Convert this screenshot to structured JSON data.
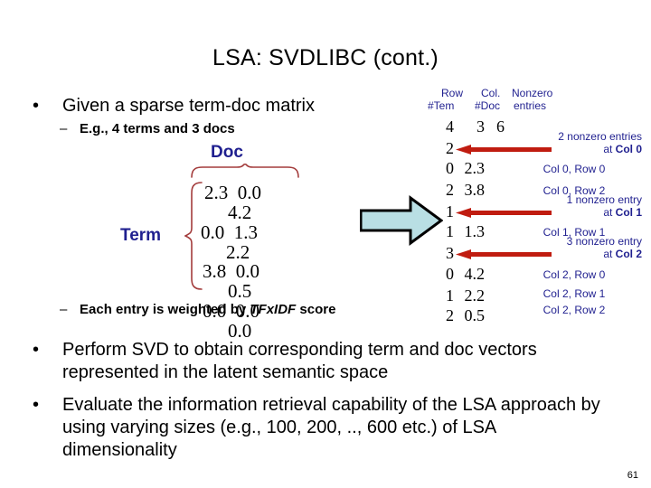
{
  "slide": {
    "title": "LSA: SVDLIBC (cont.)",
    "page_number": "61",
    "accent_blue": "#1f1f8f",
    "brace_red": "#a33c3c",
    "arrow_red": "#c01c10",
    "block_arrow_fill": "#b9dfe4"
  },
  "bullets": {
    "b1": "Given a sparse term-doc matrix",
    "sb1": "E.g., 4 terms and 3 docs",
    "sb2_pre": "Each entry is weighted by ",
    "sb2_ital": "TFxIDF",
    "sb2_post": " score",
    "b2": "Perform SVD to obtain corresponding term and doc vectors represented in the latent semantic space",
    "b3": "Evaluate the information retrieval capability of the LSA approach by using varying sizes (e.g., 100, 200, .., 600 etc.) of LSA dimensionality"
  },
  "matrix": {
    "doc_label": "Doc",
    "term_label": "Term",
    "rows": [
      {
        "first": "2.3  0.0",
        "second": "4.2"
      },
      {
        "first": "0.0  1.3",
        "second": "2.2"
      },
      {
        "first": "3.8  0.0",
        "second": "0.5"
      },
      {
        "first": "0.0  0.0",
        "second": "0.0"
      }
    ]
  },
  "table": {
    "headers": {
      "row": "Row",
      "col": "Col.",
      "nonzero": "Nonzero",
      "row_sub": "#Tem",
      "col_sub": "#Doc",
      "nonzero_sub": "entries"
    },
    "rows": [
      {
        "a": "4",
        "b": "3",
        "c": "6",
        "annot": "",
        "annot_bold": "",
        "arrow": false
      },
      {
        "a": "2",
        "b": "",
        "c": "",
        "annot": "2 nonzero entries",
        "annot2_pre": "at ",
        "annot_bold": "Col 0",
        "arrow": true
      },
      {
        "a": "0",
        "b": "2.3",
        "c": "",
        "annot": "Col 0, Row 0",
        "annot_bold": "",
        "arrow": false
      },
      {
        "a": "2",
        "b": "3.8",
        "c": "",
        "annot": "Col 0, Row 2",
        "annot_bold": "",
        "arrow": false
      },
      {
        "a": "1",
        "b": "",
        "c": "",
        "annot": "1 nonzero entry",
        "annot2_pre": "at ",
        "annot_bold": "Col 1",
        "arrow": true
      },
      {
        "a": "1",
        "b": "1.3",
        "c": "",
        "annot": "Col 1, Row 1",
        "annot_bold": "",
        "arrow": false
      },
      {
        "a": "3",
        "b": "",
        "c": "",
        "annot": "3 nonzero entry",
        "annot2_pre": "at ",
        "annot_bold": "Col 2",
        "arrow": true
      },
      {
        "a": "0",
        "b": "4.2",
        "c": "",
        "annot": "Col 2, Row 0",
        "annot_bold": "",
        "arrow": false
      },
      {
        "a": "1",
        "b": "2.2",
        "c": "",
        "annot": "Col 2, Row 1",
        "annot_bold": "",
        "arrow": false
      },
      {
        "a": "2",
        "b": "0.5",
        "c": "",
        "annot": "Col 2, Row 2",
        "annot_bold": "",
        "arrow": false
      }
    ]
  }
}
